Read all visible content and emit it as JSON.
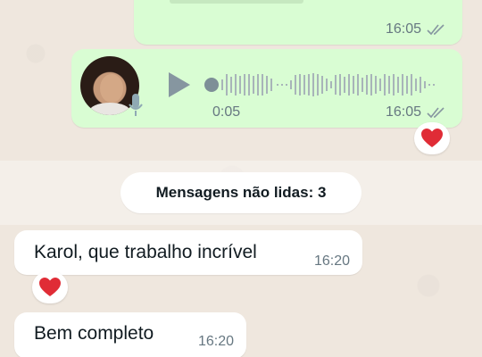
{
  "chat": {
    "top_message": {
      "time": "16:05",
      "status": "read"
    },
    "voice_message": {
      "duration": "0:05",
      "time": "16:05",
      "status": "read",
      "reaction": "❤️"
    },
    "unread_banner": "Mensagens não lidas: 3",
    "incoming": [
      {
        "text": "Karol, que trabalho incrível",
        "time": "16:20",
        "reaction": "❤️"
      },
      {
        "text": "Bem completo",
        "time": "16:20"
      }
    ]
  },
  "colors": {
    "outgoing_bubble": "#d9fdd3",
    "incoming_bubble": "#ffffff",
    "background": "#efe7de",
    "play_icon": "#8696a0",
    "read_ticks": "#8696a0"
  },
  "icons": {
    "play": "play-icon",
    "mic": "microphone-icon",
    "ticks": "double-check-icon",
    "heart": "heart-reaction-icon"
  }
}
